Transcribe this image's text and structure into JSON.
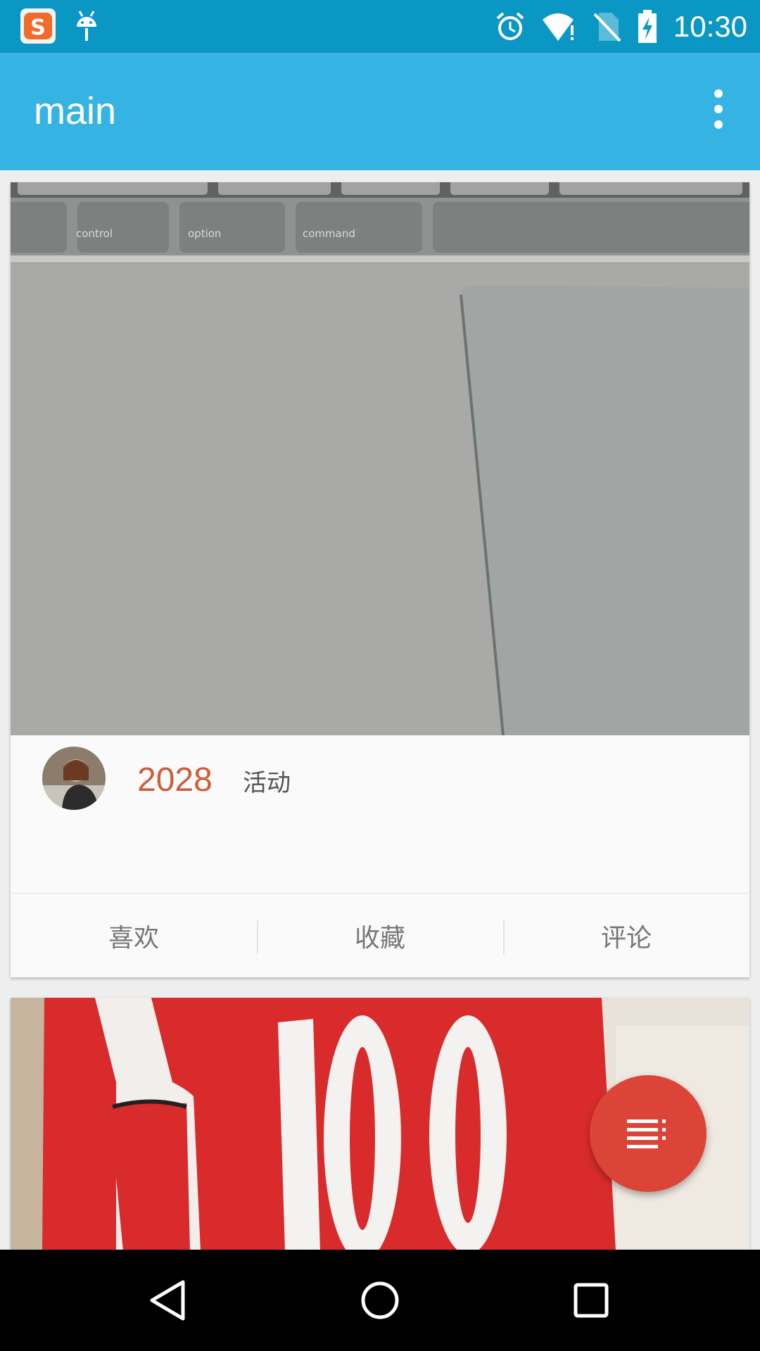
{
  "status_bar": {
    "time": "10:30",
    "icons": [
      "sogou-input-icon",
      "android-debug-icon",
      "alarm-icon",
      "wifi-icon",
      "no-sim-icon",
      "battery-charging-icon"
    ]
  },
  "app_bar": {
    "title": "main",
    "menu_icon": "more-vert-icon"
  },
  "feed": {
    "cards": [
      {
        "photo": "keyboard-trackpad-photo",
        "count": "2028",
        "tag": "活动",
        "actions": {
          "like": "喜欢",
          "favorite": "收藏",
          "comment": "评论"
        }
      },
      {
        "photo": "cola-cup-photo"
      }
    ]
  },
  "fab": {
    "icon": "list-menu-icon"
  },
  "nav_bar": {
    "icons": [
      "back-icon",
      "home-icon",
      "recents-icon"
    ]
  },
  "colors": {
    "status_bar": "#0b97c4",
    "app_bar": "#35b3e3",
    "count_accent": "#cc5d3c",
    "fab": "#dd4438"
  }
}
